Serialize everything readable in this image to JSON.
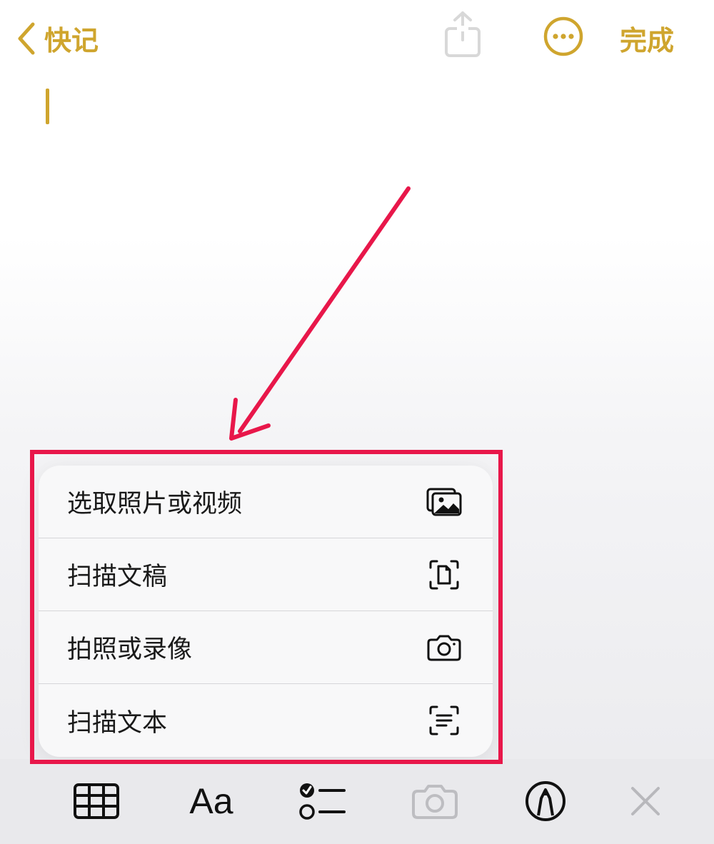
{
  "header": {
    "back_label": "快记",
    "done_label": "完成"
  },
  "menu": {
    "items": [
      {
        "label": "选取照片或视频",
        "icon": "photo-library-icon"
      },
      {
        "label": "扫描文稿",
        "icon": "scan-document-icon"
      },
      {
        "label": "拍照或录像",
        "icon": "camera-icon"
      },
      {
        "label": "扫描文本",
        "icon": "scan-text-icon"
      }
    ]
  },
  "toolbar": {
    "format_label": "Aa",
    "tools": [
      "table-icon",
      "format-text-icon",
      "checklist-icon",
      "camera-icon",
      "markup-pen-icon",
      "close-icon"
    ]
  },
  "colors": {
    "accent": "#cfa52e",
    "annotation": "#e8174a",
    "toolbar_bg": "#e9e9ec"
  }
}
